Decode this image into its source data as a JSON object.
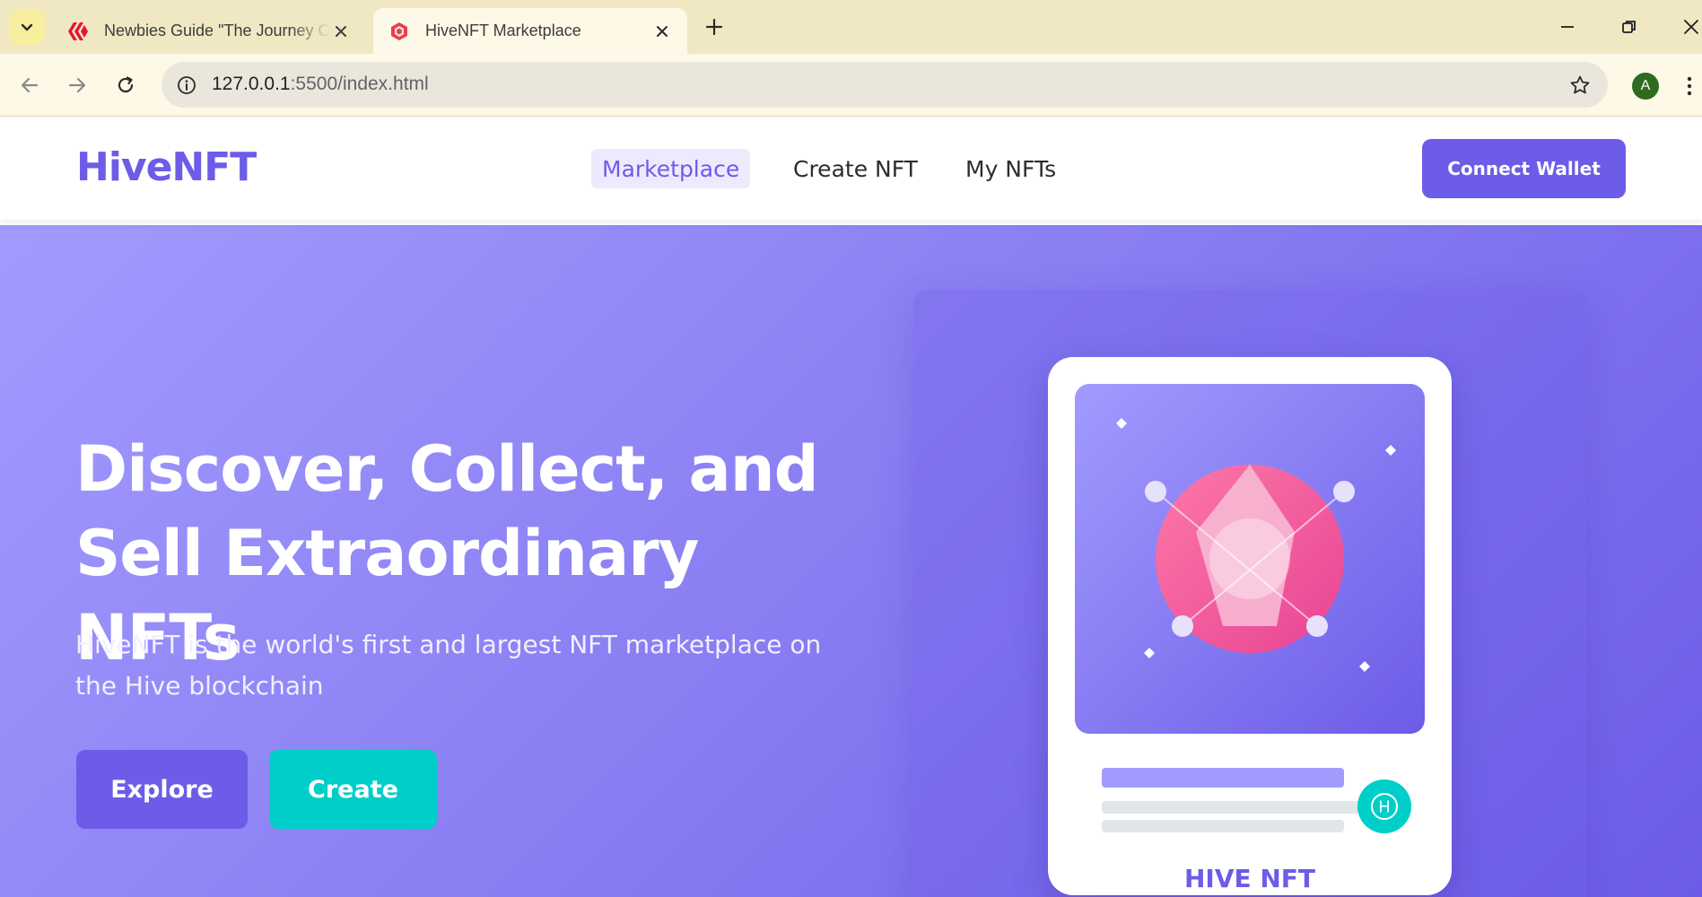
{
  "browser": {
    "tabs": [
      {
        "title": "Newbies Guide \"The Journey Of",
        "favicon": "hive-logo-icon",
        "active": false
      },
      {
        "title": "HiveNFT Marketplace",
        "favicon": "hive-favicon-icon",
        "active": true
      }
    ],
    "url_host": "127.0.0.1",
    "url_rest": ":5500/index.html",
    "profile_initial": "A"
  },
  "site": {
    "logo": "HiveNFT",
    "nav": [
      {
        "label": "Marketplace",
        "active": true
      },
      {
        "label": "Create NFT",
        "active": false
      },
      {
        "label": "My NFTs",
        "active": false
      }
    ],
    "connect_label": "Connect Wallet"
  },
  "hero": {
    "title_line1": "Discover, Collect, and",
    "title_line2": "Sell Extraordinary NFTs",
    "subtitle_line1": "HiveNFT is the world's first and largest NFT marketplace on",
    "subtitle_line2": "the Hive blockchain",
    "explore_label": "Explore",
    "create_label": "Create",
    "card_caption": "HIVE NFT",
    "badge_symbol": "H"
  },
  "colors": {
    "primary": "#6c5ce7",
    "primary_light": "#a29bfe",
    "accent": "#00cec9",
    "pink": "#fd79a8"
  }
}
